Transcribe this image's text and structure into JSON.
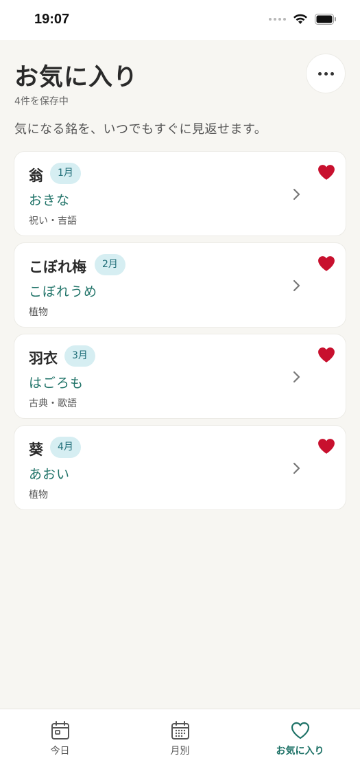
{
  "status": {
    "time": "19:07"
  },
  "header": {
    "title": "お気に入り",
    "saved_count": "4件を保存中",
    "subtitle": "気になる銘を、いつでもすぐに見返せます。"
  },
  "favorites": [
    {
      "name": "翁",
      "month": "1月",
      "reading": "おきな",
      "category": "祝い・吉語"
    },
    {
      "name": "こぼれ梅",
      "month": "2月",
      "reading": "こぼれうめ",
      "category": "植物"
    },
    {
      "name": "羽衣",
      "month": "3月",
      "reading": "はごろも",
      "category": "古典・歌語"
    },
    {
      "name": "葵",
      "month": "4月",
      "reading": "あおい",
      "category": "植物"
    }
  ],
  "tabs": [
    {
      "label": "今日",
      "icon": "calendar-today-icon"
    },
    {
      "label": "月別",
      "icon": "calendar-month-icon"
    },
    {
      "label": "お気に入り",
      "icon": "heart-outline-icon"
    }
  ],
  "colors": {
    "accent": "#1e7267",
    "heart": "#c8102e",
    "badge_bg": "#d6eef2",
    "background": "#f7f6f2"
  }
}
